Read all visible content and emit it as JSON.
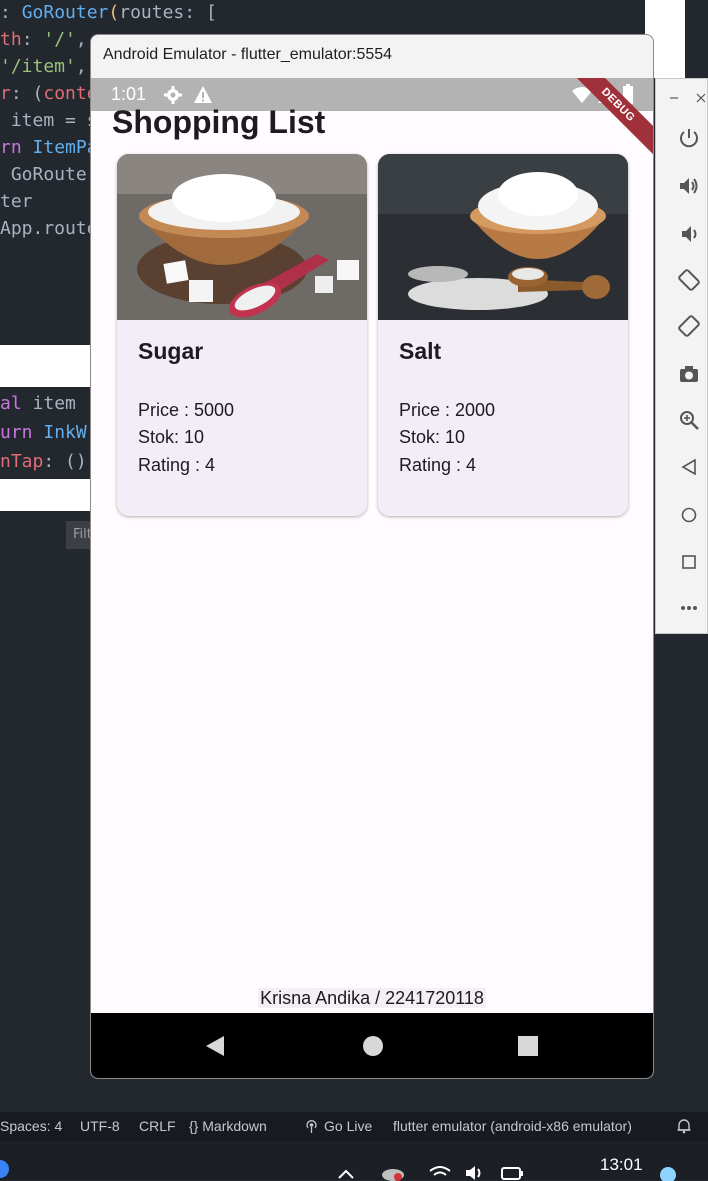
{
  "editor": {
    "code_lines": [
      {
        "parts": [
          {
            "t": ": ",
            "c": "p"
          },
          {
            "t": "GoRouter",
            "c": "fn"
          },
          {
            "t": "(",
            "c": "br"
          },
          {
            "t": "routes",
            "c": "p"
          },
          {
            "t": ": [",
            "c": "p"
          }
        ]
      },
      {
        "parts": [
          {
            "t": "th",
            "c": "prop"
          },
          {
            "t": ": ",
            "c": "p"
          },
          {
            "t": "'/'",
            "c": "str"
          },
          {
            "t": ", ",
            "c": "p"
          }
        ]
      },
      {
        "parts": [
          {
            "t": "'/item'",
            "c": "str"
          },
          {
            "t": ",",
            "c": "p"
          }
        ]
      },
      {
        "parts": [
          {
            "t": "r",
            "c": "prop"
          },
          {
            "t": ": (",
            "c": "p"
          },
          {
            "t": "conte",
            "c": "prop"
          }
        ]
      },
      {
        "parts": [
          {
            "t": " item = s",
            "c": "p"
          }
        ]
      },
      {
        "parts": [
          {
            "t": "rn ",
            "c": "kw"
          },
          {
            "t": "ItemPa",
            "c": "fn"
          }
        ]
      },
      {
        "parts": [
          {
            "t": " GoRoute",
            "c": "p"
          }
        ]
      },
      {
        "parts": [
          {
            "t": "ter",
            "c": "p"
          }
        ]
      },
      {
        "parts": [
          {
            "t": "App.route",
            "c": "p"
          }
        ]
      }
    ],
    "code_mid": [
      {
        "parts": [
          {
            "t": "al ",
            "c": "kw"
          },
          {
            "t": "item",
            "c": "p"
          }
        ]
      },
      {
        "parts": [
          {
            "t": "urn ",
            "c": "kw"
          },
          {
            "t": "InkW",
            "c": "fn"
          }
        ]
      },
      {
        "parts": [
          {
            "t": "nTap",
            "c": "prop"
          },
          {
            "t": ": ()",
            "c": "p"
          }
        ]
      }
    ],
    "filter_stub": "Filt"
  },
  "emulator": {
    "title": "Android Emulator - flutter_emulator:5554",
    "status_time": "1:01",
    "debug_label": "DEBUG"
  },
  "app": {
    "title": "Shopping List",
    "items": [
      {
        "name": "Sugar",
        "price": "Price : 5000",
        "stock": "Stok: 10",
        "rating": "Rating : 4"
      },
      {
        "name": "Salt",
        "price": "Price : 2000",
        "stock": "Stok: 10",
        "rating": "Rating : 4"
      }
    ],
    "footer": "Krisna Andika / 2241720118"
  },
  "toolbar": {
    "icons": [
      "minimize-icon",
      "close-icon",
      "power-icon",
      "volume-up-icon",
      "volume-down-icon",
      "rotate-left-icon",
      "rotate-right-icon",
      "camera-icon",
      "zoom-icon",
      "back-icon",
      "home-icon",
      "overview-icon",
      "more-icon"
    ]
  },
  "vscode_status": {
    "spaces": "Spaces: 4",
    "encoding": "UTF-8",
    "eol": "CRLF",
    "language": "{} Markdown",
    "golive": "Go Live",
    "device": "flutter emulator (android-x86 emulator)"
  },
  "taskbar": {
    "time": "13:01"
  },
  "colors": {
    "app_background": "#fffbfe",
    "card_background": "#f3edf7",
    "debug_ribbon": "#a0313a",
    "status_bar": "#b3b3b3"
  }
}
